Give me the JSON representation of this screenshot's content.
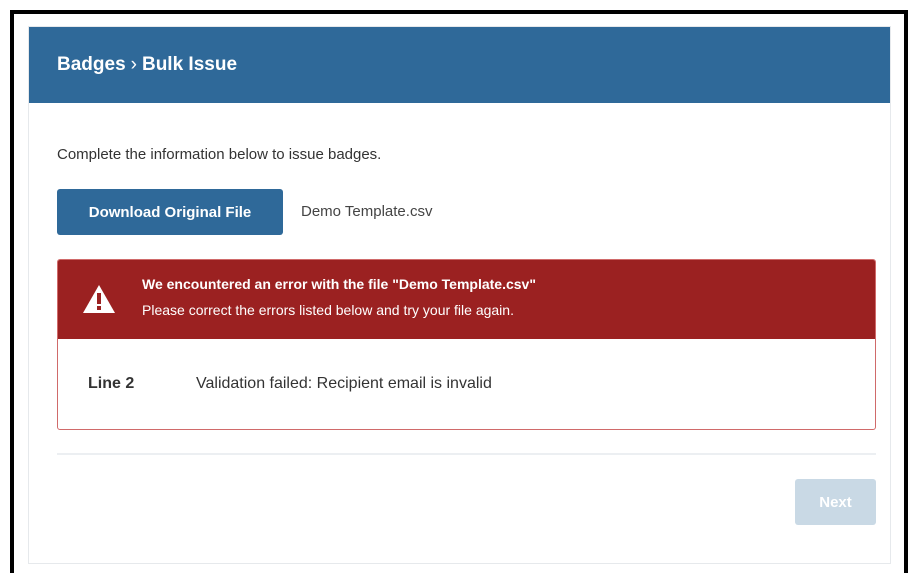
{
  "header": {
    "breadcrumb_root": "Badges",
    "separator": "›",
    "breadcrumb_current": "Bulk Issue"
  },
  "intro_text": "Complete the information below to issue badges.",
  "download": {
    "button_label": "Download Original File",
    "filename": "Demo Template.csv"
  },
  "error": {
    "icon": "warning-icon",
    "title": "We encountered an error with the file \"Demo Template.csv\"",
    "message": "Please correct the errors listed below and try your file again.",
    "rows": [
      {
        "line": "Line 2",
        "message": "Validation failed: Recipient email is invalid"
      }
    ]
  },
  "footer": {
    "next_label": "Next",
    "next_disabled": true
  },
  "colors": {
    "header_bg": "#2f6999",
    "primary_button": "#2f6999",
    "error_banner": "#9b2121",
    "error_border": "#d06a6a",
    "disabled_button": "#c9d9e5"
  }
}
